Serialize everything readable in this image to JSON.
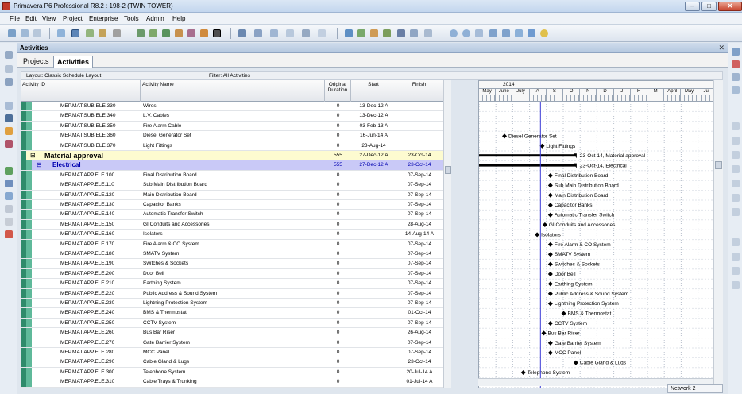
{
  "window": {
    "title": "Primavera P6 Professional R8.2 : 198-2 (TWIN TOWER)",
    "min_label": "–",
    "max_label": "□",
    "close_label": "✕"
  },
  "menu": [
    "File",
    "Edit",
    "View",
    "Project",
    "Enterprise",
    "Tools",
    "Admin",
    "Help"
  ],
  "pane": {
    "title": "Activities",
    "close_label": "✕"
  },
  "tabs": [
    "Projects",
    "Activities"
  ],
  "layout_label": "Layout: Classic Schedule Layout",
  "filter_label": "Filter: All Activities",
  "columns": {
    "id": "Activity ID",
    "name": "Activity Name",
    "duration": "Original Duration",
    "start": "Start",
    "finish": "Finish"
  },
  "rows": [
    {
      "type": "task",
      "id": "MEP.MAT.SUB.ELE.330",
      "name": "Wires",
      "duration": "0",
      "start": "13-Dec-12 A",
      "finish": ""
    },
    {
      "type": "task",
      "id": "MEP.MAT.SUB.ELE.340",
      "name": "L.V. Cables",
      "duration": "0",
      "start": "13-Dec-12 A",
      "finish": ""
    },
    {
      "type": "task",
      "id": "MEP.MAT.SUB.ELE.350",
      "name": "Fire Alarm Cable",
      "duration": "0",
      "start": "03-Feb-13 A",
      "finish": ""
    },
    {
      "type": "task",
      "id": "MEP.MAT.SUB.ELE.360",
      "name": "Diesel Generator Set",
      "duration": "0",
      "start": "16-Jun-14 A",
      "finish": ""
    },
    {
      "type": "task",
      "id": "MEP.MAT.SUB.ELE.370",
      "name": "Light Fittings",
      "duration": "0",
      "start": "23-Aug-14",
      "finish": ""
    },
    {
      "type": "wbs1",
      "id": "Material approval",
      "name": "",
      "duration": "555",
      "start": "27-Dec-12 A",
      "finish": "23-Oct-14"
    },
    {
      "type": "wbs2",
      "id": "Electrical",
      "name": "",
      "duration": "555",
      "start": "27-Dec-12 A",
      "finish": "23-Oct-14"
    },
    {
      "type": "task",
      "id": "MEP.MAT.APP.ELE.100",
      "name": "Final Distribution Board",
      "duration": "0",
      "start": "",
      "finish": "07-Sep-14"
    },
    {
      "type": "task",
      "id": "MEP.MAT.APP.ELE.110",
      "name": "Sub Main Distribution Board",
      "duration": "0",
      "start": "",
      "finish": "07-Sep-14"
    },
    {
      "type": "task",
      "id": "MEP.MAT.APP.ELE.120",
      "name": "Main Distribution Board",
      "duration": "0",
      "start": "",
      "finish": "07-Sep-14"
    },
    {
      "type": "task",
      "id": "MEP.MAT.APP.ELE.130",
      "name": "Capacitor Banks",
      "duration": "0",
      "start": "",
      "finish": "07-Sep-14"
    },
    {
      "type": "task",
      "id": "MEP.MAT.APP.ELE.140",
      "name": "Automatic Transfer Switch",
      "duration": "0",
      "start": "",
      "finish": "07-Sep-14"
    },
    {
      "type": "task",
      "id": "MEP.MAT.APP.ELE.150",
      "name": "GI Conduits and Accessories",
      "duration": "0",
      "start": "",
      "finish": "28-Aug-14"
    },
    {
      "type": "task",
      "id": "MEP.MAT.APP.ELE.160",
      "name": "Isolators",
      "duration": "0",
      "start": "",
      "finish": "14-Aug-14 A"
    },
    {
      "type": "task",
      "id": "MEP.MAT.APP.ELE.170",
      "name": "Fire Alarm & CO System",
      "duration": "0",
      "start": "",
      "finish": "07-Sep-14"
    },
    {
      "type": "task",
      "id": "MEP.MAT.APP.ELE.180",
      "name": "SMATV System",
      "duration": "0",
      "start": "",
      "finish": "07-Sep-14"
    },
    {
      "type": "task",
      "id": "MEP.MAT.APP.ELE.190",
      "name": "Switches & Sockets",
      "duration": "0",
      "start": "",
      "finish": "07-Sep-14"
    },
    {
      "type": "task",
      "id": "MEP.MAT.APP.ELE.200",
      "name": "Door Bell",
      "duration": "0",
      "start": "",
      "finish": "07-Sep-14"
    },
    {
      "type": "task",
      "id": "MEP.MAT.APP.ELE.210",
      "name": "Earthing System",
      "duration": "0",
      "start": "",
      "finish": "07-Sep-14"
    },
    {
      "type": "task",
      "id": "MEP.MAT.APP.ELE.220",
      "name": "Public Address & Sound System",
      "duration": "0",
      "start": "",
      "finish": "07-Sep-14"
    },
    {
      "type": "task",
      "id": "MEP.MAT.APP.ELE.230",
      "name": "Lightning Protection System",
      "duration": "0",
      "start": "",
      "finish": "07-Sep-14"
    },
    {
      "type": "task",
      "id": "MEP.MAT.APP.ELE.240",
      "name": "BMS & Thermostat",
      "duration": "0",
      "start": "",
      "finish": "01-Oct-14"
    },
    {
      "type": "task",
      "id": "MEP.MAT.APP.ELE.250",
      "name": "CCTV System",
      "duration": "0",
      "start": "",
      "finish": "07-Sep-14"
    },
    {
      "type": "task",
      "id": "MEP.MAT.APP.ELE.260",
      "name": "Bus Bar Riser",
      "duration": "0",
      "start": "",
      "finish": "26-Aug-14"
    },
    {
      "type": "task",
      "id": "MEP.MAT.APP.ELE.270",
      "name": "Gate Barrier System",
      "duration": "0",
      "start": "",
      "finish": "07-Sep-14"
    },
    {
      "type": "task",
      "id": "MEP.MAT.APP.ELE.280",
      "name": "MCC Panel",
      "duration": "0",
      "start": "",
      "finish": "07-Sep-14"
    },
    {
      "type": "task",
      "id": "MEP.MAT.APP.ELE.290",
      "name": "Cable Gland & Lugs",
      "duration": "0",
      "start": "",
      "finish": "23-Oct-14"
    },
    {
      "type": "task",
      "id": "MEP.MAT.APP.ELE.300",
      "name": "Telephone System",
      "duration": "0",
      "start": "",
      "finish": "20-Jul-14 A"
    },
    {
      "type": "task",
      "id": "MEP.MAT.APP.ELE.310",
      "name": "Cable Trays & Trunking",
      "duration": "0",
      "start": "",
      "finish": "01-Jul-14 A"
    }
  ],
  "gantt": {
    "year": "2014",
    "months": [
      "May",
      "June",
      "July",
      "A",
      "S",
      "O",
      "N",
      "D",
      "J",
      "F",
      "M",
      "April",
      "May",
      "Ju"
    ],
    "data_date": "2014-08-20",
    "bars": [
      {
        "row": 5,
        "label": "23-Oct-14, Material approval"
      },
      {
        "row": 6,
        "label": "23-Oct-14, Electrical"
      }
    ],
    "milestones": [
      {
        "row": 3,
        "date": "2014-06-16",
        "label": "Diesel Generator Set"
      },
      {
        "row": 4,
        "date": "2014-08-23",
        "label": "Light Fittings"
      },
      {
        "row": 7,
        "date": "2014-09-07",
        "label": "Final Distribution Board"
      },
      {
        "row": 8,
        "date": "2014-09-07",
        "label": "Sub Main Distribution Board"
      },
      {
        "row": 9,
        "date": "2014-09-07",
        "label": "Main Distribution Board"
      },
      {
        "row": 10,
        "date": "2014-09-07",
        "label": "Capacitor Banks"
      },
      {
        "row": 11,
        "date": "2014-09-07",
        "label": "Automatic Transfer Switch"
      },
      {
        "row": 12,
        "date": "2014-08-28",
        "label": "GI Conduits and Accessories"
      },
      {
        "row": 13,
        "date": "2014-08-14",
        "label": "Isolators"
      },
      {
        "row": 14,
        "date": "2014-09-07",
        "label": "Fire Alarm & CO System"
      },
      {
        "row": 15,
        "date": "2014-09-07",
        "label": "SMATV System"
      },
      {
        "row": 16,
        "date": "2014-09-07",
        "label": "Switches & Sockets"
      },
      {
        "row": 17,
        "date": "2014-09-07",
        "label": "Door Bell"
      },
      {
        "row": 18,
        "date": "2014-09-07",
        "label": "Earthing System"
      },
      {
        "row": 19,
        "date": "2014-09-07",
        "label": "Public Address & Sound System"
      },
      {
        "row": 20,
        "date": "2014-09-07",
        "label": "Lightning Protection System"
      },
      {
        "row": 21,
        "date": "2014-10-01",
        "label": "BMS & Thermostat"
      },
      {
        "row": 22,
        "date": "2014-09-07",
        "label": "CCTV System"
      },
      {
        "row": 23,
        "date": "2014-08-26",
        "label": "Bus Bar Riser"
      },
      {
        "row": 24,
        "date": "2014-09-07",
        "label": "Gate Barrier System"
      },
      {
        "row": 25,
        "date": "2014-09-07",
        "label": "MCC Panel"
      },
      {
        "row": 26,
        "date": "2014-10-23",
        "label": "Cable Gland & Lugs"
      },
      {
        "row": 27,
        "date": "2014-07-20",
        "label": "Telephone System"
      }
    ]
  },
  "status": "Network 2",
  "colors": {
    "wbs1_bg": "#fdfbd0",
    "wbs2_bg": "#c9c9f7",
    "wbs2_text": "#0000b0",
    "band_dark": "#2e8b6b",
    "band_light": "#5fb99a",
    "data_date_line": "#3b3bd6"
  }
}
